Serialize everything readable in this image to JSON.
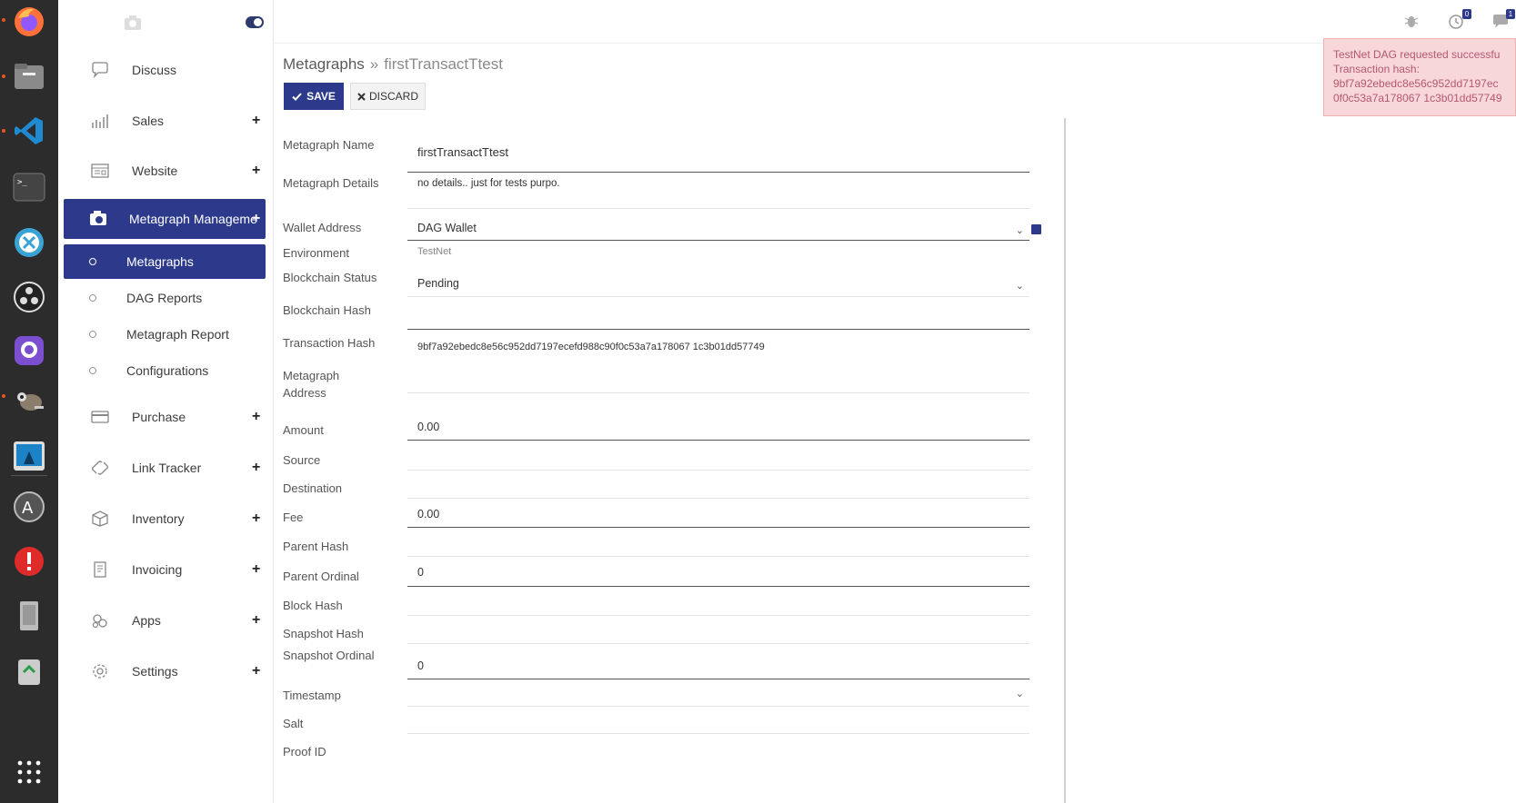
{
  "sidebar": {
    "items": [
      {
        "label": "Discuss",
        "icon": "chat-icon",
        "plus": ""
      },
      {
        "label": "Sales",
        "icon": "chart-icon",
        "plus": "+"
      },
      {
        "label": "Website",
        "icon": "website-icon",
        "plus": "+"
      },
      {
        "label": "Metagraph Manageme",
        "icon": "camera-icon",
        "plus": "+"
      },
      {
        "label": "Purchase",
        "icon": "credit-card-icon",
        "plus": "+"
      },
      {
        "label": "Link Tracker",
        "icon": "link-icon",
        "plus": "+"
      },
      {
        "label": "Inventory",
        "icon": "box-icon",
        "plus": "+"
      },
      {
        "label": "Invoicing",
        "icon": "invoice-icon",
        "plus": "+"
      },
      {
        "label": "Apps",
        "icon": "apps-icon",
        "plus": "+"
      },
      {
        "label": "Settings",
        "icon": "gear-icon",
        "plus": "+"
      }
    ],
    "subitems": [
      {
        "label": "Metagraphs"
      },
      {
        "label": "DAG Reports"
      },
      {
        "label": "Metagraph Report"
      },
      {
        "label": "Configurations"
      }
    ]
  },
  "topbar": {
    "bug_icon": "bug-icon",
    "activity_badge": "0",
    "messages_badge": "1"
  },
  "breadcrumb": {
    "parent": "Metagraphs",
    "separator": "»",
    "current": "firstTransactTtest"
  },
  "buttons": {
    "save": "SAVE",
    "discard": "DISCARD"
  },
  "form": {
    "metagraph_name_label": "Metagraph Name",
    "metagraph_name_value": "firstTransactTtest",
    "metagraph_details_label": "Metagraph Details",
    "metagraph_details_value": "no details.. just for tests purpo.",
    "wallet_address_label": "Wallet Address",
    "wallet_address_value": "DAG Wallet",
    "environment_label": "Environment",
    "environment_value": "TestNet",
    "blockchain_status_label": "Blockchain Status",
    "blockchain_status_value": "Pending",
    "blockchain_hash_label": "Blockchain Hash",
    "blockchain_hash_value": "",
    "transaction_hash_label": "Transaction Hash",
    "transaction_hash_value": "9bf7a92ebedc8e56c952dd7197ecefd988c90f0c53a7a178067 1c3b01dd57749",
    "metagraph_address_label": "Metagraph Address",
    "metagraph_address_value": "",
    "amount_label": "Amount",
    "amount_value": "0.00",
    "source_label": "Source",
    "source_value": "",
    "destination_label": "Destination",
    "destination_value": "",
    "fee_label": "Fee",
    "fee_value": "0.00",
    "parent_hash_label": "Parent Hash",
    "parent_hash_value": "",
    "parent_ordinal_label": "Parent Ordinal",
    "parent_ordinal_value": "0",
    "block_hash_label": "Block Hash",
    "block_hash_value": "",
    "snapshot_hash_label": "Snapshot Hash",
    "snapshot_hash_value": "",
    "snapshot_ordinal_label": "Snapshot Ordinal",
    "snapshot_ordinal_value": "0",
    "timestamp_label": "Timestamp",
    "timestamp_value": "",
    "salt_label": "Salt",
    "salt_value": "",
    "proof_id_label": "Proof ID"
  },
  "notification": {
    "line1": "TestNet DAG requested successfu",
    "line2": "Transaction hash:",
    "line3": "9bf7a92ebedc8e56c952dd7197ec",
    "line4": "0f0c53a7a178067 1c3b01dd57749"
  },
  "colors": {
    "accent": "#2d3a8c",
    "notification_bg": "#f8d7da",
    "notification_text": "#b5586a",
    "dock_bg": "#2c2c2c"
  }
}
